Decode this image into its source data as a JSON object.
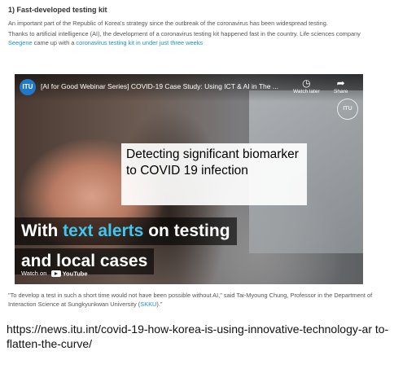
{
  "article": {
    "heading": "1) Fast-developed testing kit",
    "para1": "An important part of the Republic of Korea's strategy since the outbreak of the coronavirus has been widespread testing.",
    "para2_before": "Thanks to artificial intelligence (AI), the development of a coronavirus testing kit happened fast in the country. Life sciences company ",
    "para2_link1": "Seegene",
    "para2_middle": " came up with a ",
    "para2_link2": "coronavirus testing kit in under just three weeks",
    "link_color": "#1a8fc9"
  },
  "video": {
    "channel_logo_text": "ITU",
    "title": "[AI for Good Webinar Series] COVID-19 Case Study: Using ICT & AI in The ...",
    "watch_later_label": "Watch later",
    "share_label": "Share",
    "watermark": "ITU",
    "callout_text": "Detecting significant biomarker to COVID 19 infection",
    "caption_line1_prefix": "With ",
    "caption_line1_accent": "text alerts",
    "caption_line1_suffix": " on testing",
    "caption_line2": "and local cases",
    "caption_accent_color": "#3ec8f0",
    "watch_on_label": "Watch on",
    "youtube_label": "YouTube",
    "icons": {
      "watch_later": "clock-icon",
      "share": "share-arrow-icon",
      "youtube": "youtube-icon"
    }
  },
  "quote": {
    "text_before": "\"To develop a test in such a short time would not have been possible without AI,\" said Tai-Myoung Chung, Professor in the Department of Interaction Science at Sungkyunkwan University (",
    "link": "SKKU",
    "text_after": ").\""
  },
  "source_url": "https://news.itu.int/covid-19-how-korea-is-using-innovative-technology-ar to-flatten-the-curve/"
}
